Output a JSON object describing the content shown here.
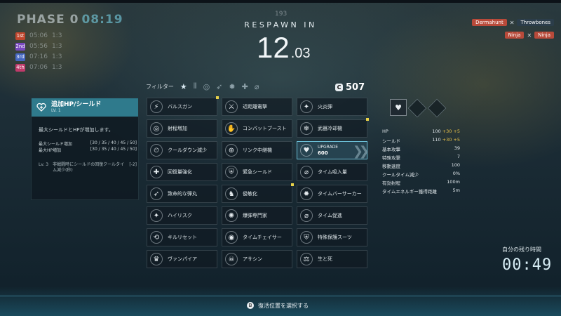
{
  "hud": {
    "phase_label": "PHASE 0",
    "phase_time": "08:19",
    "enemy_marker": "193",
    "respawn_label": "RESPAWN IN",
    "respawn_seconds": "12",
    "respawn_fraction": ".03",
    "roster": [
      {
        "tag": "1st",
        "time": "05:06",
        "score": "1:3",
        "color": "#c0472e"
      },
      {
        "tag": "2nd",
        "time": "05:56",
        "score": "1:3",
        "color": "#7a49c0"
      },
      {
        "tag": "3rd",
        "time": "07:16",
        "score": "1:3",
        "color": "#4466c0"
      },
      {
        "tag": "4th",
        "time": "07:06",
        "score": "1:3",
        "color": "#c03a6a"
      }
    ],
    "killfeed": [
      {
        "left": "Dermahunt",
        "right": "Throwbones",
        "left_color": "#b84a3a",
        "right_color": "#2b3d4a"
      },
      {
        "left": "Ninja",
        "right": "Ninja",
        "left_color": "#b84a3a",
        "right_color": "#b84a3a"
      }
    ]
  },
  "filter": {
    "label": "フィルター",
    "icons": [
      "star-icon",
      "bars-icon",
      "target-icon",
      "bullet-icon",
      "burst-icon",
      "plus-icon",
      "null-icon"
    ]
  },
  "currency": {
    "icon": "C",
    "amount": "507"
  },
  "detail": {
    "title": "追加HP/シールド",
    "level": "LV. 1",
    "description": "最大シールドとHPが増加します。",
    "stats": [
      {
        "label": "最大シールド増加",
        "value": "[30 / 35 / 40 / 45 / 50]"
      },
      {
        "label": "最大HP増加",
        "value": "[30 / 35 / 40 / 45 / 50]"
      }
    ],
    "level_note": {
      "lv": "Lv. 3",
      "text": "非戦闘時にシールドの回復クールタイム減少(秒)",
      "value": "[-2]"
    }
  },
  "augments": [
    {
      "label": "バルスガン",
      "icon": "⚡",
      "icon_name": "pulse-gun-icon",
      "dot": true
    },
    {
      "label": "近距離電撃",
      "icon": "⚔",
      "icon_name": "shock-icon",
      "dot": false
    },
    {
      "label": "火炎弾",
      "icon": "✦",
      "icon_name": "fire-round-icon",
      "dot": false
    },
    {
      "label": "射程増加",
      "icon": "◎",
      "icon_name": "range-icon",
      "dot": false
    },
    {
      "label": "コンバットブースト",
      "icon": "✋",
      "icon_name": "combat-boost-icon",
      "dot": false
    },
    {
      "label": "武器冷却機",
      "icon": "❄",
      "icon_name": "weapon-cooler-icon",
      "dot": true
    },
    {
      "label": "クールダウン減少",
      "icon": "⏲",
      "icon_name": "cooldown-icon",
      "dot": false
    },
    {
      "label": "リンク中継機",
      "icon": "⊕",
      "icon_name": "link-relay-icon",
      "dot": false
    },
    {
      "label": "UPGRADE",
      "icon": "♥",
      "icon_name": "hp-shield-icon",
      "dot": false,
      "selected": true,
      "cost": "600"
    },
    {
      "label": "回復量強化",
      "icon": "✚",
      "icon_name": "heal-boost-icon",
      "dot": false
    },
    {
      "label": "緊急シールド",
      "icon": "⛨",
      "icon_name": "emergency-shield-icon",
      "dot": false
    },
    {
      "label": "タイム吸入量",
      "icon": "⌀",
      "icon_name": "time-absorb-icon",
      "dot": false
    },
    {
      "label": "致命的な弾丸",
      "icon": "➶",
      "icon_name": "lethal-round-icon",
      "dot": false
    },
    {
      "label": "俊敏化",
      "icon": "♞",
      "icon_name": "agility-icon",
      "dot": true
    },
    {
      "label": "タイムバーサーカー",
      "icon": "✹",
      "icon_name": "time-berserker-icon",
      "dot": false
    },
    {
      "label": "ハイリスク",
      "icon": "✦",
      "icon_name": "high-risk-icon",
      "dot": false
    },
    {
      "label": "爆弾専門家",
      "icon": "✺",
      "icon_name": "bomb-expert-icon",
      "dot": false
    },
    {
      "label": "タイム促進",
      "icon": "⌀",
      "icon_name": "time-boost-icon",
      "dot": false
    },
    {
      "label": "キルリセット",
      "icon": "⟲",
      "icon_name": "kill-reset-icon",
      "dot": false
    },
    {
      "label": "タイムチェイサー",
      "icon": "◉",
      "icon_name": "time-chaser-icon",
      "dot": false
    },
    {
      "label": "特殊保護スーツ",
      "icon": "⛨",
      "icon_name": "protective-suit-icon",
      "dot": false
    },
    {
      "label": "ヴァンパイア",
      "icon": "♛",
      "icon_name": "vampire-icon",
      "dot": false
    },
    {
      "label": "アサシン",
      "icon": "☠",
      "icon_name": "assassin-icon",
      "dot": false
    },
    {
      "label": "生と死",
      "icon": "⚖",
      "icon_name": "life-death-icon",
      "dot": false
    }
  ],
  "stats": [
    {
      "label": "HP",
      "value": "100",
      "bonus": "+30 +5"
    },
    {
      "label": "シールド",
      "value": "110",
      "bonus": "+30 +5"
    },
    {
      "label": "基本攻撃",
      "value": "39",
      "bonus": ""
    },
    {
      "label": "特殊攻撃",
      "value": "7",
      "bonus": ""
    },
    {
      "label": "移動速度",
      "value": "100",
      "bonus": ""
    },
    {
      "label": "クールタイム減少",
      "value": "0%",
      "bonus": ""
    },
    {
      "label": "有効射程",
      "value": "100m",
      "bonus": ""
    },
    {
      "label": "タイムエネルギー獲得距離",
      "value": "5m",
      "bonus": ""
    }
  ],
  "timer": {
    "label": "自分の残り時間",
    "value": "00:49"
  },
  "action": {
    "button": "B",
    "label": "復活位置を選択する"
  }
}
